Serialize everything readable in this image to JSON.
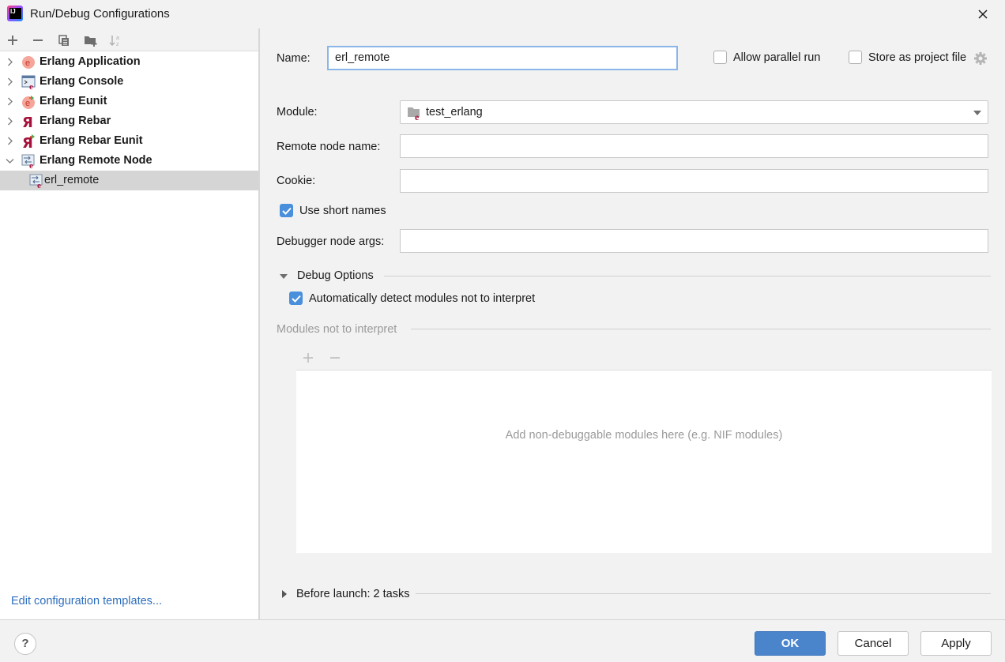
{
  "window": {
    "title": "Run/Debug Configurations",
    "close_icon": "close-icon"
  },
  "left_toolbar": {
    "icons": [
      "add-icon",
      "remove-icon",
      "copy-icon",
      "new-folder-icon",
      "sort-alphabetically-icon"
    ]
  },
  "tree": {
    "items": [
      {
        "label": "Erlang Application",
        "icon": "erlang-application-icon",
        "expanded": false,
        "bold": true
      },
      {
        "label": "Erlang Console",
        "icon": "erlang-console-icon",
        "expanded": false,
        "bold": true
      },
      {
        "label": "Erlang Eunit",
        "icon": "erlang-eunit-icon",
        "expanded": false,
        "bold": true
      },
      {
        "label": "Erlang Rebar",
        "icon": "erlang-rebar-icon",
        "expanded": false,
        "bold": true
      },
      {
        "label": "Erlang Rebar Eunit",
        "icon": "erlang-rebar-eunit-icon",
        "expanded": false,
        "bold": true
      },
      {
        "label": "Erlang Remote Node",
        "icon": "erlang-remote-node-icon",
        "expanded": true,
        "bold": true
      },
      {
        "label": "erl_remote",
        "icon": "erlang-remote-node-icon",
        "selected": true,
        "bold": false
      }
    ],
    "edit_templates_link": "Edit configuration templates..."
  },
  "form": {
    "name_label": "Name:",
    "name_value": "erl_remote",
    "allow_parallel_label": "Allow parallel run",
    "allow_parallel_checked": false,
    "store_project_label": "Store as project file",
    "store_project_checked": false,
    "module_label": "Module:",
    "module_value": "test_erlang",
    "remote_node_label": "Remote node name:",
    "remote_node_value": "",
    "cookie_label": "Cookie:",
    "cookie_value": "",
    "short_names_label": "Use short names",
    "short_names_checked": true,
    "debugger_args_label": "Debugger node args:",
    "debugger_args_value": "",
    "debug_options_label": "Debug Options",
    "auto_detect_label": "Automatically detect modules not to interpret",
    "auto_detect_checked": true,
    "modules_not_interpret_label": "Modules not to interpret",
    "modules_empty_text": "Add non-debuggable modules here (e.g. NIF modules)",
    "before_launch_label": "Before launch: 2 tasks"
  },
  "footer": {
    "help_label": "?",
    "ok_label": "OK",
    "cancel_label": "Cancel",
    "apply_label": "Apply"
  },
  "colors": {
    "accent": "#4a85cc",
    "link": "#2e6ebd",
    "selection": "#d5d5d5",
    "erlang_red": "#a6113c"
  }
}
